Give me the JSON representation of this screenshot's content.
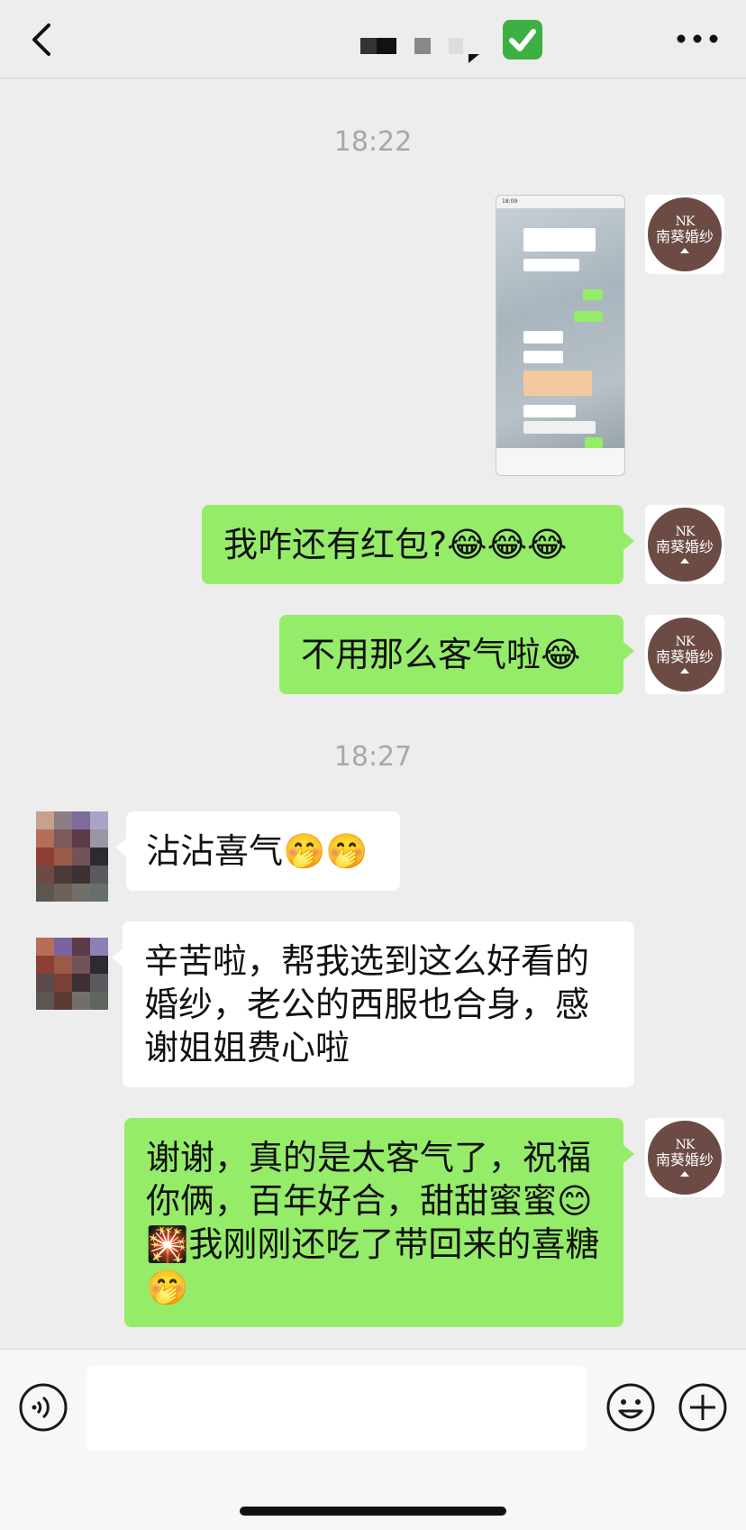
{
  "header": {
    "back_icon": "chevron-left-icon",
    "more_icon": "ellipsis-icon",
    "verified_icon": "check-mark-button-icon",
    "verified_color": "#3cb043"
  },
  "messages": {
    "time1": "18:22",
    "m_out_1": "我咋还有红包?😂😂😂",
    "m_out_2": "不用那么客气啦😂",
    "time2": "18:27",
    "m_in_1": "沾沾喜气🤭🤭",
    "m_in_2": "辛苦啦，帮我选到这么好看的婚纱，老公的西服也合身，感谢姐姐费心啦",
    "m_out_3": "谢谢，真的是太客气了，祝福你俩，百年好合，甜甜蜜蜜😊🎇我刚刚还吃了带回来的喜糖🤭"
  },
  "screenshot_thumb": {
    "time": "18:09"
  },
  "brand": {
    "logo_initials": "NK",
    "logo_name": "南葵婚纱",
    "color": "#6b4b44",
    "bubble_green": "#95ec69"
  },
  "input_bar": {
    "voice_icon": "voice-icon",
    "emoji_icon": "emoji-icon",
    "plus_icon": "plus-icon"
  }
}
